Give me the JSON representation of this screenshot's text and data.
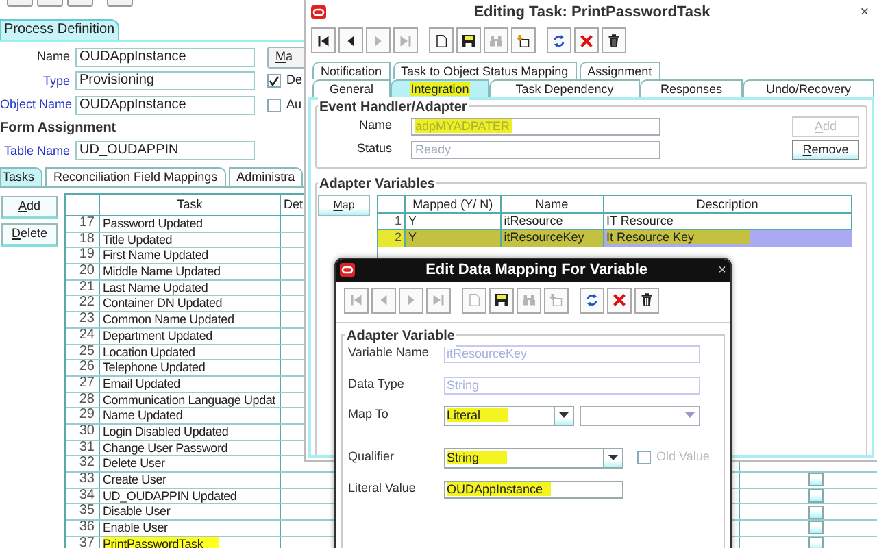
{
  "main": {
    "process_tab": {
      "label": "Process Definition",
      "selected": true
    },
    "fields": [
      {
        "label": "Name",
        "value": "OUDAppInstance",
        "lookup": false
      },
      {
        "label": "Type",
        "value": "Provisioning",
        "lookup": true
      },
      {
        "label": "Object Name",
        "value": "OUDAppInstance",
        "lookup": true
      }
    ],
    "map_button": "Ma",
    "options": [
      {
        "label": "De",
        "checked": true
      },
      {
        "label": "Au",
        "checked": false
      }
    ],
    "form_assignment": {
      "title": "Form Assignment",
      "label": "Table Name",
      "value": "UD_OUDAPPIN",
      "lookup": true
    },
    "tabs": [
      {
        "label": "Tasks",
        "selected": true
      },
      {
        "label": "Reconciliation Field Mappings",
        "selected": false
      },
      {
        "label": "Administra",
        "selected": false
      }
    ],
    "buttons": [
      "Add",
      "Delete"
    ],
    "task_table": {
      "columns": [
        "Task",
        "Det"
      ],
      "rows": [
        {
          "number": "17",
          "task": "Password Updated",
          "highlighted": false
        },
        {
          "number": "18",
          "task": "Title Updated",
          "highlighted": false
        },
        {
          "number": "19",
          "task": "First Name Updated",
          "highlighted": false
        },
        {
          "number": "20",
          "task": "Middle Name Updated",
          "highlighted": false
        },
        {
          "number": "21",
          "task": "Last Name Updated",
          "highlighted": false
        },
        {
          "number": "22",
          "task": "Container DN Updated",
          "highlighted": false
        },
        {
          "number": "23",
          "task": "Common Name Updated",
          "highlighted": false
        },
        {
          "number": "24",
          "task": "Department Updated",
          "highlighted": false
        },
        {
          "number": "25",
          "task": "Location Updated",
          "highlighted": false
        },
        {
          "number": "26",
          "task": "Telephone Updated",
          "highlighted": false
        },
        {
          "number": "27",
          "task": "Email Updated",
          "highlighted": false
        },
        {
          "number": "28",
          "task": "Communication Language Updat",
          "highlighted": false
        },
        {
          "number": "29",
          "task": "Name Updated",
          "highlighted": false
        },
        {
          "number": "30",
          "task": "Login Disabled Updated",
          "highlighted": false
        },
        {
          "number": "31",
          "task": "Change User Password",
          "highlighted": false
        },
        {
          "number": "32",
          "task": "Delete User",
          "highlighted": false
        },
        {
          "number": "33",
          "task": "Create User",
          "highlighted": false
        },
        {
          "number": "34",
          "task": "UD_OUDAPPIN Updated",
          "highlighted": false
        },
        {
          "number": "35",
          "task": "Disable User",
          "highlighted": false
        },
        {
          "number": "36",
          "task": "Enable User",
          "highlighted": false
        },
        {
          "number": "37",
          "task": "PrintPasswordTask",
          "highlighted": true
        }
      ],
      "visible_row_checkboxes": [
        {
          "checked": false
        },
        {
          "checked": false
        },
        {
          "checked": false
        },
        {
          "checked": false
        },
        {
          "checked": false
        }
      ]
    }
  },
  "editing_task": {
    "title": "Editing Task: PrintPasswordTask",
    "close": "×",
    "toolbar": [
      {
        "kind": "first",
        "disabled": false
      },
      {
        "kind": "prev",
        "disabled": false
      },
      {
        "kind": "next",
        "disabled": true
      },
      {
        "kind": "last",
        "disabled": true
      },
      {
        "kind": "new",
        "disabled": false
      },
      {
        "kind": "save",
        "disabled": false
      },
      {
        "kind": "find",
        "disabled": true
      },
      {
        "kind": "tool",
        "disabled": false
      },
      {
        "kind": "refresh",
        "disabled": false
      },
      {
        "kind": "delete",
        "disabled": false
      },
      {
        "kind": "trash",
        "disabled": false
      }
    ],
    "tabs_row_1": [
      {
        "label": "Notification",
        "selected": false
      },
      {
        "label": "Task to Object Status Mapping",
        "selected": false
      },
      {
        "label": "Assignment",
        "selected": false
      }
    ],
    "tabs_row_2": [
      {
        "label": "General",
        "selected": false,
        "highlighted": false
      },
      {
        "label": "Integration",
        "selected": true,
        "highlighted": true
      },
      {
        "label": "Task Dependency",
        "selected": false,
        "highlighted": false
      },
      {
        "label": "Responses",
        "selected": false,
        "highlighted": false
      },
      {
        "label": "Undo/Recovery",
        "selected": false,
        "highlighted": false
      }
    ],
    "event_handler": {
      "title": "Event Handler/Adapter",
      "fields": [
        {
          "label": "Name",
          "value": "adpMYADPATER",
          "highlighted": true
        },
        {
          "label": "Status",
          "value": "Ready",
          "highlighted": false
        }
      ],
      "buttons": [
        {
          "label": "Add",
          "disabled": true
        },
        {
          "label": "Remove",
          "disabled": false
        }
      ]
    },
    "adapter_variables": {
      "title": "Adapter Variables",
      "map_button": "Map",
      "columns": [
        "Mapped (Y/ N)",
        "Name",
        "Description"
      ],
      "rows": [
        {
          "number": "1",
          "mapped": "Y",
          "name": "itResource",
          "description": "IT Resource",
          "selected": false,
          "highlighted": false
        },
        {
          "number": "2",
          "mapped": "Y",
          "name": "itResourceKey",
          "description": "It Resource Key",
          "selected": true,
          "highlighted": true
        }
      ]
    }
  },
  "data_mapping": {
    "title": "Edit Data Mapping For Variable",
    "close": "×",
    "toolbar": [
      {
        "kind": "first",
        "disabled": true
      },
      {
        "kind": "prev",
        "disabled": true
      },
      {
        "kind": "next",
        "disabled": true
      },
      {
        "kind": "last",
        "disabled": true
      },
      {
        "kind": "new",
        "disabled": true
      },
      {
        "kind": "save",
        "disabled": false
      },
      {
        "kind": "find",
        "disabled": true
      },
      {
        "kind": "tool",
        "disabled": true
      },
      {
        "kind": "refresh",
        "disabled": false
      },
      {
        "kind": "delete",
        "disabled": false
      },
      {
        "kind": "trash",
        "disabled": false
      }
    ],
    "group": "Adapter Variable",
    "fields": [
      {
        "kind": "text",
        "label": "Variable Name",
        "value": "itResourceKey",
        "disabled": true,
        "highlighted": false
      },
      {
        "kind": "text",
        "label": "Data Type",
        "value": "String",
        "disabled": true,
        "highlighted": false
      },
      {
        "kind": "double_combo",
        "label": "Map To",
        "value": "Literal",
        "highlighted": true
      },
      {
        "kind": "combo_check",
        "label": "Qualifier",
        "value": "String",
        "highlighted": true,
        "option": {
          "label": "Old Value",
          "checked": false
        }
      },
      {
        "kind": "text",
        "label": "Literal Value",
        "value": "OUDAppInstance",
        "disabled": false,
        "highlighted": true
      }
    ]
  }
}
